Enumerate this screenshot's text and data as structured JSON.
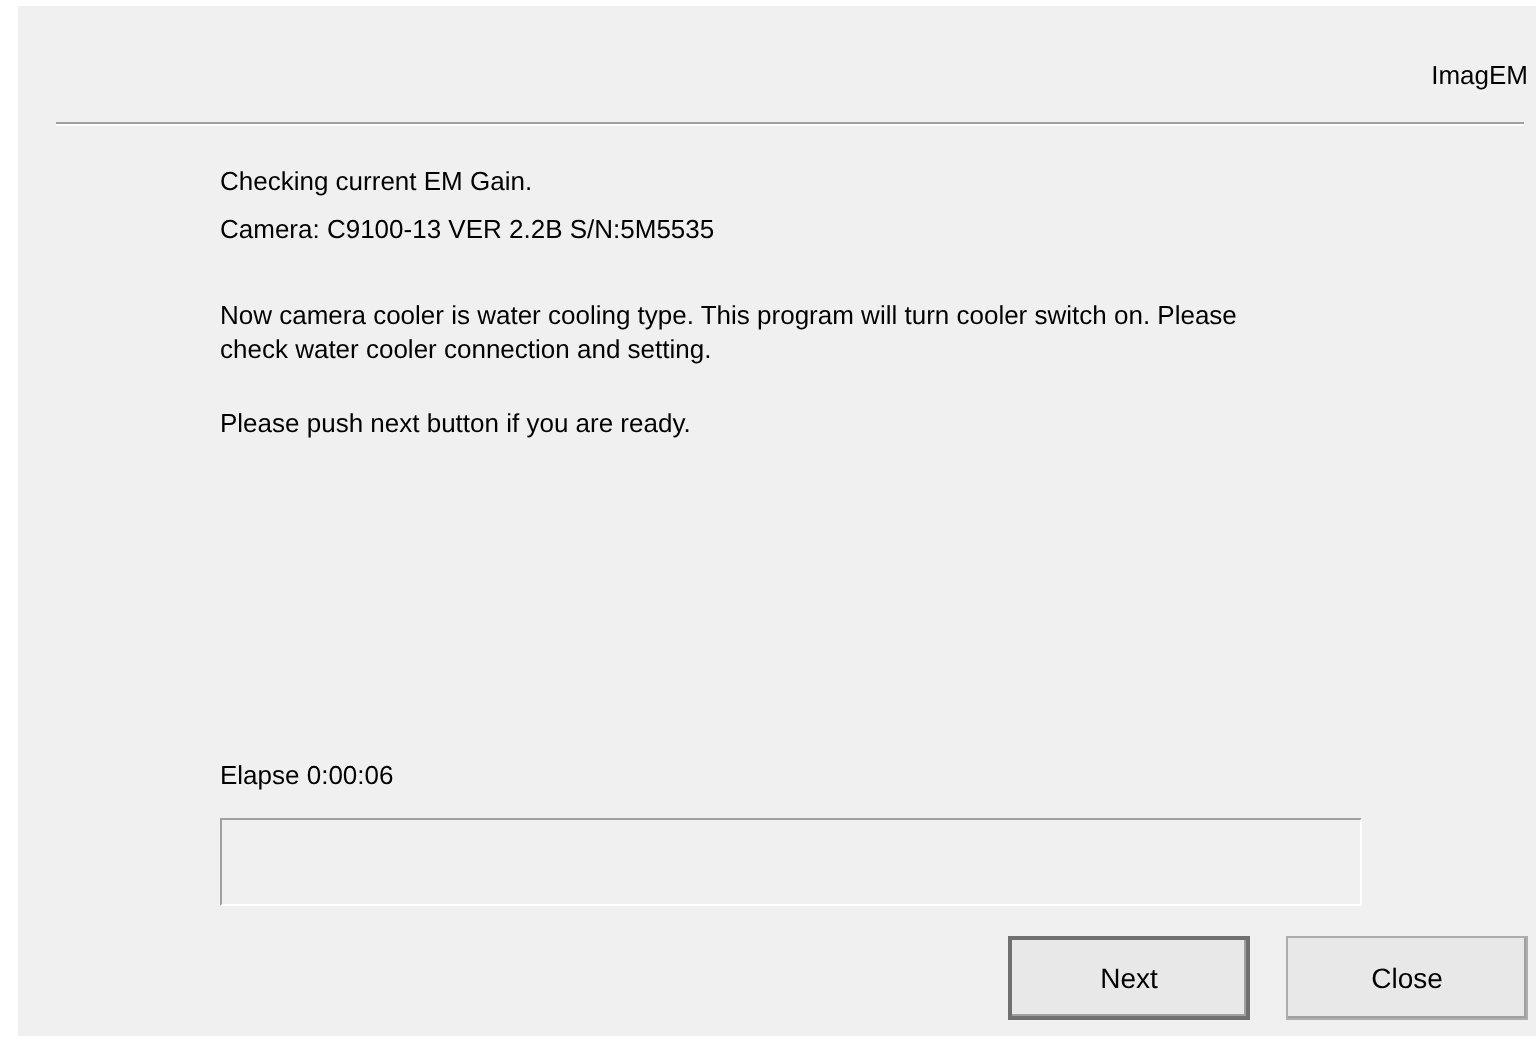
{
  "header": {
    "title": "ImagEM"
  },
  "messages": [
    "Checking current EM Gain.",
    "Camera: C9100-13 VER 2.2B S/N:5M5535"
  ],
  "paragraphs": [
    "Now camera cooler is water cooling type. This program will turn cooler switch on. Please check water cooler connection and setting.",
    "Please push next button if you are ready."
  ],
  "elapsed": "Elapse 0:00:06",
  "progress": {
    "level": 0
  },
  "buttons": [
    {
      "label": "Next",
      "default": true
    },
    {
      "label": "Close",
      "default": false
    }
  ]
}
